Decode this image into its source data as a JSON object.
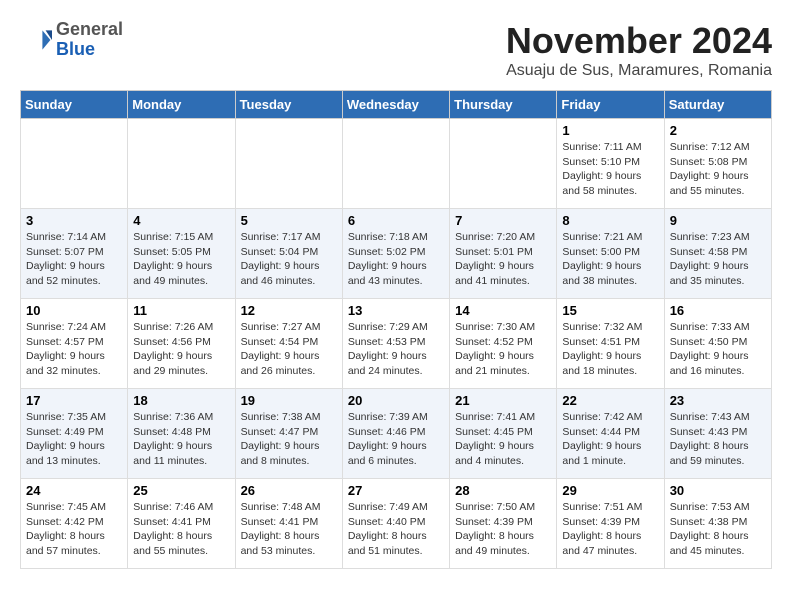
{
  "header": {
    "logo_line1": "General",
    "logo_line2": "Blue",
    "month_title": "November 2024",
    "subtitle": "Asuaju de Sus, Maramures, Romania"
  },
  "days_of_week": [
    "Sunday",
    "Monday",
    "Tuesday",
    "Wednesday",
    "Thursday",
    "Friday",
    "Saturday"
  ],
  "weeks": [
    [
      {
        "day": "",
        "info": ""
      },
      {
        "day": "",
        "info": ""
      },
      {
        "day": "",
        "info": ""
      },
      {
        "day": "",
        "info": ""
      },
      {
        "day": "",
        "info": ""
      },
      {
        "day": "1",
        "info": "Sunrise: 7:11 AM\nSunset: 5:10 PM\nDaylight: 9 hours and 58 minutes."
      },
      {
        "day": "2",
        "info": "Sunrise: 7:12 AM\nSunset: 5:08 PM\nDaylight: 9 hours and 55 minutes."
      }
    ],
    [
      {
        "day": "3",
        "info": "Sunrise: 7:14 AM\nSunset: 5:07 PM\nDaylight: 9 hours and 52 minutes."
      },
      {
        "day": "4",
        "info": "Sunrise: 7:15 AM\nSunset: 5:05 PM\nDaylight: 9 hours and 49 minutes."
      },
      {
        "day": "5",
        "info": "Sunrise: 7:17 AM\nSunset: 5:04 PM\nDaylight: 9 hours and 46 minutes."
      },
      {
        "day": "6",
        "info": "Sunrise: 7:18 AM\nSunset: 5:02 PM\nDaylight: 9 hours and 43 minutes."
      },
      {
        "day": "7",
        "info": "Sunrise: 7:20 AM\nSunset: 5:01 PM\nDaylight: 9 hours and 41 minutes."
      },
      {
        "day": "8",
        "info": "Sunrise: 7:21 AM\nSunset: 5:00 PM\nDaylight: 9 hours and 38 minutes."
      },
      {
        "day": "9",
        "info": "Sunrise: 7:23 AM\nSunset: 4:58 PM\nDaylight: 9 hours and 35 minutes."
      }
    ],
    [
      {
        "day": "10",
        "info": "Sunrise: 7:24 AM\nSunset: 4:57 PM\nDaylight: 9 hours and 32 minutes."
      },
      {
        "day": "11",
        "info": "Sunrise: 7:26 AM\nSunset: 4:56 PM\nDaylight: 9 hours and 29 minutes."
      },
      {
        "day": "12",
        "info": "Sunrise: 7:27 AM\nSunset: 4:54 PM\nDaylight: 9 hours and 26 minutes."
      },
      {
        "day": "13",
        "info": "Sunrise: 7:29 AM\nSunset: 4:53 PM\nDaylight: 9 hours and 24 minutes."
      },
      {
        "day": "14",
        "info": "Sunrise: 7:30 AM\nSunset: 4:52 PM\nDaylight: 9 hours and 21 minutes."
      },
      {
        "day": "15",
        "info": "Sunrise: 7:32 AM\nSunset: 4:51 PM\nDaylight: 9 hours and 18 minutes."
      },
      {
        "day": "16",
        "info": "Sunrise: 7:33 AM\nSunset: 4:50 PM\nDaylight: 9 hours and 16 minutes."
      }
    ],
    [
      {
        "day": "17",
        "info": "Sunrise: 7:35 AM\nSunset: 4:49 PM\nDaylight: 9 hours and 13 minutes."
      },
      {
        "day": "18",
        "info": "Sunrise: 7:36 AM\nSunset: 4:48 PM\nDaylight: 9 hours and 11 minutes."
      },
      {
        "day": "19",
        "info": "Sunrise: 7:38 AM\nSunset: 4:47 PM\nDaylight: 9 hours and 8 minutes."
      },
      {
        "day": "20",
        "info": "Sunrise: 7:39 AM\nSunset: 4:46 PM\nDaylight: 9 hours and 6 minutes."
      },
      {
        "day": "21",
        "info": "Sunrise: 7:41 AM\nSunset: 4:45 PM\nDaylight: 9 hours and 4 minutes."
      },
      {
        "day": "22",
        "info": "Sunrise: 7:42 AM\nSunset: 4:44 PM\nDaylight: 9 hours and 1 minute."
      },
      {
        "day": "23",
        "info": "Sunrise: 7:43 AM\nSunset: 4:43 PM\nDaylight: 8 hours and 59 minutes."
      }
    ],
    [
      {
        "day": "24",
        "info": "Sunrise: 7:45 AM\nSunset: 4:42 PM\nDaylight: 8 hours and 57 minutes."
      },
      {
        "day": "25",
        "info": "Sunrise: 7:46 AM\nSunset: 4:41 PM\nDaylight: 8 hours and 55 minutes."
      },
      {
        "day": "26",
        "info": "Sunrise: 7:48 AM\nSunset: 4:41 PM\nDaylight: 8 hours and 53 minutes."
      },
      {
        "day": "27",
        "info": "Sunrise: 7:49 AM\nSunset: 4:40 PM\nDaylight: 8 hours and 51 minutes."
      },
      {
        "day": "28",
        "info": "Sunrise: 7:50 AM\nSunset: 4:39 PM\nDaylight: 8 hours and 49 minutes."
      },
      {
        "day": "29",
        "info": "Sunrise: 7:51 AM\nSunset: 4:39 PM\nDaylight: 8 hours and 47 minutes."
      },
      {
        "day": "30",
        "info": "Sunrise: 7:53 AM\nSunset: 4:38 PM\nDaylight: 8 hours and 45 minutes."
      }
    ]
  ]
}
